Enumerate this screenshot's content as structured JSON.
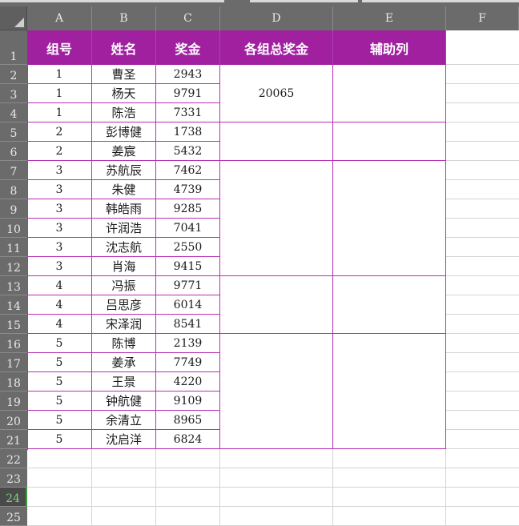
{
  "columns": [
    "A",
    "B",
    "C",
    "D",
    "E",
    "F"
  ],
  "headers": [
    "组号",
    "姓名",
    "奖金",
    "各组总奖金",
    "辅助列"
  ],
  "row_numbers": [
    "1",
    "2",
    "3",
    "4",
    "5",
    "6",
    "7",
    "8",
    "9",
    "10",
    "11",
    "12",
    "13",
    "14",
    "15",
    "16",
    "17",
    "18",
    "19",
    "20",
    "21",
    "22",
    "23",
    "24",
    "25"
  ],
  "active_row": "24",
  "rows": [
    {
      "group": "1",
      "name": "曹圣",
      "bonus": "2943"
    },
    {
      "group": "1",
      "name": "杨天",
      "bonus": "9791"
    },
    {
      "group": "1",
      "name": "陈浩",
      "bonus": "7331"
    },
    {
      "group": "2",
      "name": "彭博健",
      "bonus": "1738"
    },
    {
      "group": "2",
      "name": "姜宸",
      "bonus": "5432"
    },
    {
      "group": "3",
      "name": "苏航辰",
      "bonus": "7462"
    },
    {
      "group": "3",
      "name": "朱健",
      "bonus": "4739"
    },
    {
      "group": "3",
      "name": "韩皓雨",
      "bonus": "9285"
    },
    {
      "group": "3",
      "name": "许润浩",
      "bonus": "7041"
    },
    {
      "group": "3",
      "name": "沈志航",
      "bonus": "2550"
    },
    {
      "group": "3",
      "name": "肖海",
      "bonus": "9415"
    },
    {
      "group": "4",
      "name": "冯振",
      "bonus": "9771"
    },
    {
      "group": "4",
      "name": "吕思彦",
      "bonus": "6014"
    },
    {
      "group": "4",
      "name": "宋泽润",
      "bonus": "8541"
    },
    {
      "group": "5",
      "name": "陈博",
      "bonus": "2139"
    },
    {
      "group": "5",
      "name": "姜承",
      "bonus": "7749"
    },
    {
      "group": "5",
      "name": "王景",
      "bonus": "4220"
    },
    {
      "group": "5",
      "name": "钟航健",
      "bonus": "9109"
    },
    {
      "group": "5",
      "name": "余清立",
      "bonus": "8965"
    },
    {
      "group": "5",
      "name": "沈启洋",
      "bonus": "6824"
    }
  ],
  "group_totals": [
    "20065",
    "",
    "",
    "",
    ""
  ],
  "colors": {
    "header_bg": "#a020a0",
    "border": "#b52fb5",
    "chrome": "#6b6b6b",
    "active_row": "#3a9a3a"
  }
}
